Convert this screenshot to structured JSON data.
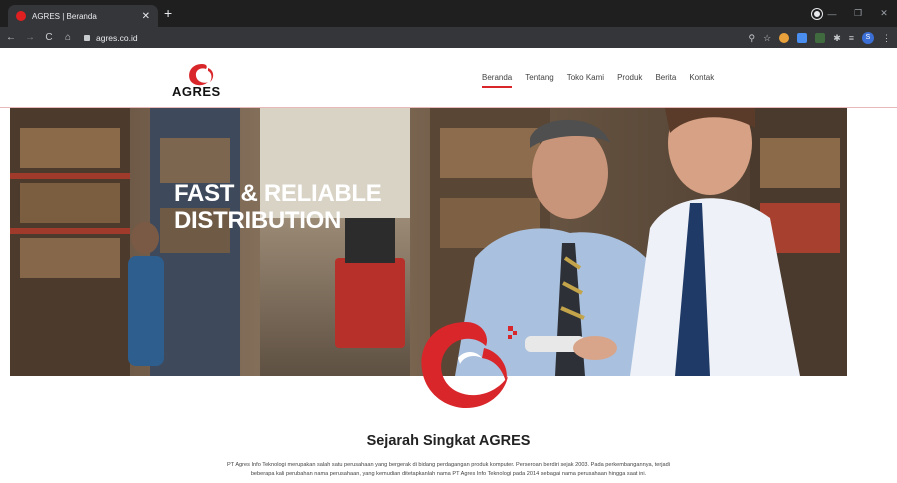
{
  "browser": {
    "tab_title": "AGRES | Beranda",
    "url": "agres.co.id",
    "profile_initial": "S"
  },
  "site": {
    "brand": "AGRES",
    "nav": [
      "Beranda",
      "Tentang",
      "Toko Kami",
      "Produk",
      "Berita",
      "Kontak"
    ],
    "active_nav": "Beranda",
    "hero_line1": "FAST & RELIABLE",
    "hero_line2": "DISTRIBUTION",
    "section_title": "Sejarah Singkat AGRES",
    "section_text_1": "PT Agres Info Teknologi merupakan salah satu perusahaan yang bergerak di bidang perdagangan produk komputer. Perseroan berdiri sejak 2003. Pada perkembangannya, terjadi",
    "section_text_2": "beberapa kali perubahan nama perusahaan, yang kemudian ditetapkanlah nama PT Agres Info Teknologi pada 2014 sebagai nama perusahaan hingga saat ini."
  },
  "colors": {
    "brand_red": "#d9262a",
    "chrome_dark": "#1f1f20",
    "chrome_toolbar": "#35363a"
  }
}
